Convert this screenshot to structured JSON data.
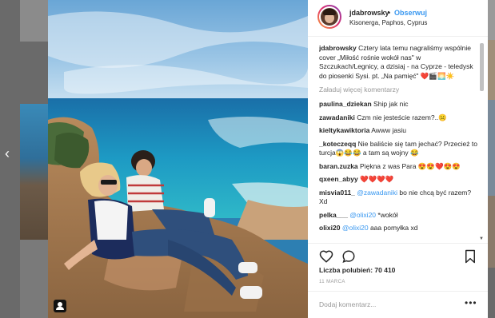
{
  "nav": {
    "prev_icon": "chevron-left-icon",
    "prev_glyph": "‹"
  },
  "post": {
    "author": {
      "username": "jdabrowsky",
      "separator": "•",
      "follow_label": "Obserwuj",
      "location": "Kisonerga, Paphos, Cyprus"
    },
    "caption": {
      "username": "jdabrowsky",
      "text": "Cztery lata temu nagraliśmy wspólnie cover „Miłość rośnie wokół nas\" w Szczukach/Legnicy, a dzisiaj - na Cyprze - teledysk do piosenki Sysi. pt. „Na pamięć\" ❤️🎬🌅☀️"
    },
    "load_more_label": "Załaduj więcej komentarzy",
    "comments": [
      {
        "user": "paulina_dziekan",
        "text": "Ship jak nic",
        "mention": ""
      },
      {
        "user": "zawadaniki",
        "text": "Czm nie jesteście razem?..☹️",
        "mention": ""
      },
      {
        "user": "kieltykawiktoria",
        "text": "Awww jasiu",
        "mention": ""
      },
      {
        "user": "_koteczeqq",
        "text": "Nie baliście się tam jechać? Przecież to turcja😱😂😂 a tam są wojny 😂",
        "mention": ""
      },
      {
        "user": "baran.zuzka",
        "text": "Piękna z was Para 😍😍❤️😍😍",
        "mention": ""
      },
      {
        "user": "qxeen_abyy",
        "text": "❤️❤️❤️❤️",
        "mention": ""
      },
      {
        "user": "misvia011_",
        "mention": "@zawadaniki",
        "text": "bo nie chcą być razem? Xd"
      },
      {
        "user": "pelka___",
        "mention": "@olixi20",
        "text": "*wokół"
      },
      {
        "user": "olixi20",
        "mention": "@olixi20",
        "text": "aaa pomyłka xd"
      }
    ],
    "likes_label": "Liczba polubień: 70 410",
    "date": "11 MARCA",
    "add_comment_placeholder": "Dodaj komentarz...",
    "more_label": "•••"
  },
  "icons": {
    "like": "heart-icon",
    "comment": "comment-icon",
    "save": "bookmark-icon",
    "tag": "user-tag-icon"
  },
  "colors": {
    "accent": "#3897f0",
    "sea": "#1f8fc0",
    "sky": "#7fb6de"
  }
}
